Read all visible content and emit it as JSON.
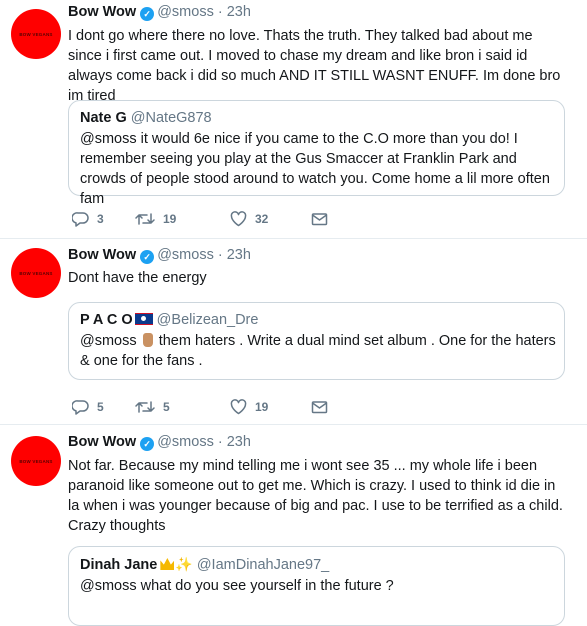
{
  "tweets": [
    {
      "avatar_text": "BOW VEGANS",
      "name": "Bow Wow",
      "handle": "@smoss",
      "time": "23h",
      "text": "I dont go where there no love. Thats the truth. They talked bad about me since i first came out. I moved to chase my dream and like bron i said id always come back i did so much AND IT STILL WASNT ENUFF. Im done bro im tired",
      "quote": {
        "name": "Nate G",
        "handle": "@NateG878",
        "text": "@smoss it would 6e nice if you came to the C.O more than you do! I remember seeing you play at the Gus Smaccer at Franklin Park and crowds of people stood around to watch you. Come home a lil more often fam"
      },
      "replies": "3",
      "retweets": "19",
      "likes": "32"
    },
    {
      "avatar_text": "BOW VEGANS",
      "name": "Bow Wow",
      "handle": "@smoss",
      "time": "23h",
      "text": "Dont have the energy",
      "quote": {
        "name": "P A C O",
        "handle": "@Belizean_Dre",
        "text_before": "@smoss",
        "text_after": "them haters . Write a dual mind set album . One for the haters & one for the fans ."
      },
      "replies": "5",
      "retweets": "5",
      "likes": "19"
    },
    {
      "avatar_text": "BOW VEGANS",
      "name": "Bow Wow",
      "handle": "@smoss",
      "time": "23h",
      "text": "Not far. Because my mind telling me i wont see 35 ... my whole life i been paranoid like someone out to get me. Which is crazy. I used to think id die in la when i was younger because of big and pac. I use to be terrified as a child. Crazy thoughts",
      "quote": {
        "name": "Dinah Jane",
        "handle": "@IamDinahJane97_",
        "text": "@smoss what do you see yourself in the future ?"
      }
    }
  ],
  "colors": {
    "accent": "#1da1f2",
    "avatar": "#ff0000",
    "muted": "#657786",
    "border": "#e6ecf0"
  },
  "icons": [
    "reply-icon",
    "retweet-icon",
    "like-icon",
    "dm-icon",
    "verified-badge-icon",
    "belize-flag-icon",
    "middle-finger-icon",
    "crown-icon",
    "sparkles-icon"
  ]
}
